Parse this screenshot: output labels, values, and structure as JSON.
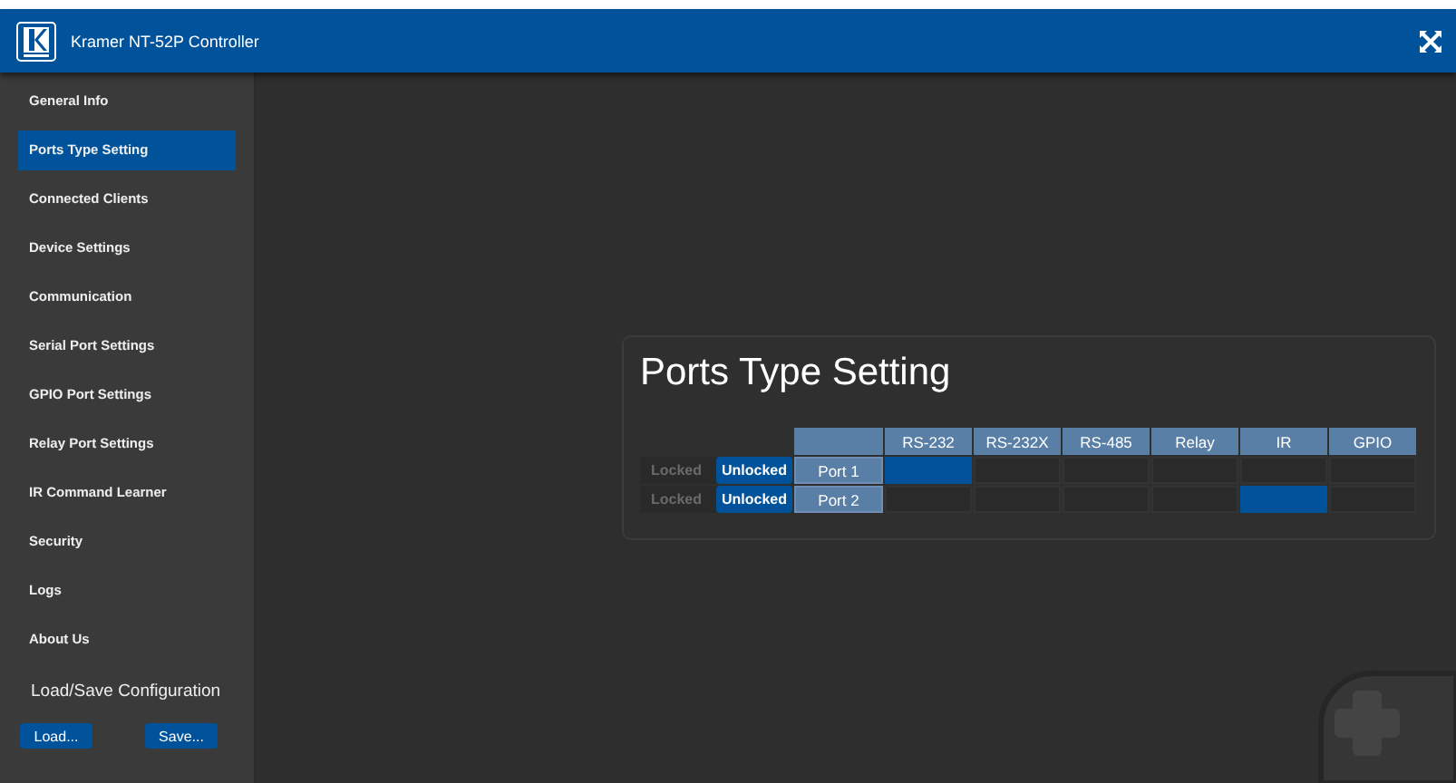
{
  "header": {
    "title": "Kramer NT-52P Controller"
  },
  "sidebar": {
    "items": [
      {
        "label": "General Info",
        "selected": false
      },
      {
        "label": "Ports Type Setting",
        "selected": true
      },
      {
        "label": "Connected Clients",
        "selected": false
      },
      {
        "label": "Device Settings",
        "selected": false
      },
      {
        "label": "Communication",
        "selected": false
      },
      {
        "label": "Serial Port Settings",
        "selected": false
      },
      {
        "label": "GPIO Port Settings",
        "selected": false
      },
      {
        "label": "Relay Port Settings",
        "selected": false
      },
      {
        "label": "IR Command Learner",
        "selected": false
      },
      {
        "label": "Security",
        "selected": false
      },
      {
        "label": "Logs",
        "selected": false
      },
      {
        "label": "About Us",
        "selected": false
      }
    ],
    "config": {
      "title": "Load/Save Configuration",
      "buttons": [
        "Load...",
        "Save..."
      ]
    }
  },
  "panel": {
    "title": "Ports Type Setting",
    "columns": [
      "RS-232",
      "RS-232X",
      "RS-485",
      "Relay",
      "IR",
      "GPIO"
    ],
    "ports": [
      {
        "name": "Port 1",
        "lock": [
          {
            "label": "Locked",
            "selected": false
          },
          {
            "label": "Unlocked",
            "selected": true
          }
        ],
        "types": [
          true,
          false,
          false,
          false,
          false,
          false
        ]
      },
      {
        "name": "Port 2",
        "lock": [
          {
            "label": "Locked",
            "selected": false
          },
          {
            "label": "Unlocked",
            "selected": true
          }
        ],
        "types": [
          false,
          false,
          false,
          false,
          true,
          false
        ]
      }
    ]
  }
}
